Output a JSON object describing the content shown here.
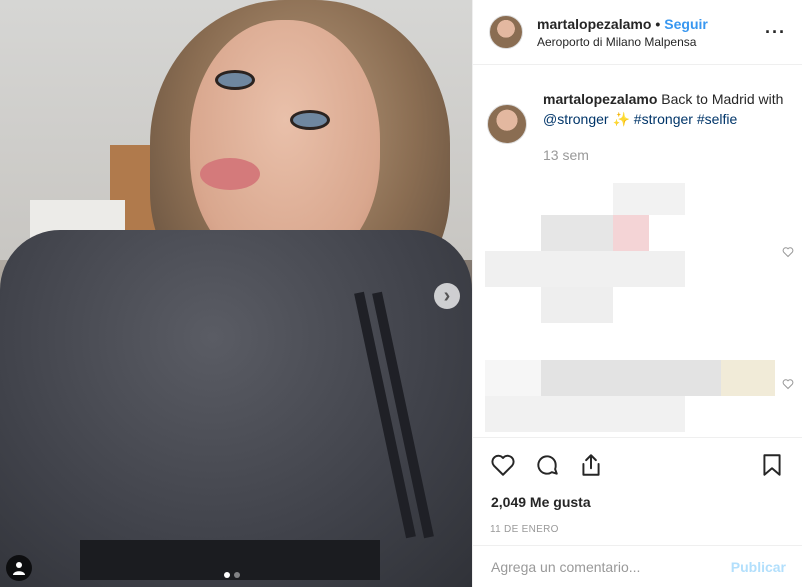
{
  "post": {
    "username": "martalopezalamo",
    "bullet": "•",
    "follow_label": "Seguir",
    "location": "Aeroporto di Milano Malpensa",
    "more_icon": "more-horizontal-icon",
    "more_label": "···"
  },
  "media": {
    "next_icon": "chevron-right-icon",
    "next_label": "›",
    "user_tag_icon": "user-icon",
    "carousel_count": 2,
    "carousel_active": 0
  },
  "caption": {
    "username": "martalopezalamo",
    "text": "Back to Madrid with",
    "mention": "@stronger",
    "emoji": "✨",
    "hashtags": "#stronger #selfie",
    "time": "13 sem"
  },
  "actions": {
    "like_icon": "heart-icon",
    "comment_icon": "comment-icon",
    "share_icon": "share-icon",
    "save_icon": "bookmark-icon",
    "likes": "2,049 Me gusta",
    "date": "11 DE ENERO"
  },
  "comment_form": {
    "placeholder": "Agrega un comentario...",
    "publish_label": "Publicar"
  },
  "colors": {
    "accent": "#3897f0",
    "publish_disabled": "#b2dffc",
    "text": "#262626",
    "muted": "#999999",
    "border": "#efefef"
  }
}
